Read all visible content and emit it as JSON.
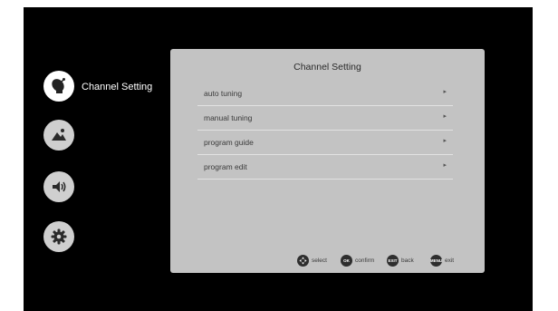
{
  "sidebar": {
    "items": [
      {
        "icon": "satellite-dish-icon",
        "label": "Channel Setting",
        "active": true
      },
      {
        "icon": "picture-icon",
        "label": "",
        "active": false
      },
      {
        "icon": "speaker-icon",
        "label": "",
        "active": false
      },
      {
        "icon": "gear-icon",
        "label": "",
        "active": false
      }
    ]
  },
  "panel": {
    "title": "Channel Setting",
    "menu": [
      {
        "label": "auto tuning",
        "arrow": "▸"
      },
      {
        "label": "manual tuning",
        "arrow": "▸"
      },
      {
        "label": "program guide",
        "arrow": "▸"
      },
      {
        "label": "program edit",
        "arrow": "▸"
      }
    ]
  },
  "footer": {
    "hints": [
      {
        "key": "",
        "icon": "dpad-icon",
        "label": "select"
      },
      {
        "key": "OK",
        "label": "confirm"
      },
      {
        "key": "EXIT",
        "label": "back"
      },
      {
        "key": "MENU",
        "label": "exit"
      }
    ]
  },
  "colors": {
    "screen_bg": "#000000",
    "panel_bg": "#c3c3c3",
    "active_icon_bg": "#ffffff",
    "inactive_icon_bg": "#cfcfcf",
    "hint_key_bg": "#2e2e2e"
  }
}
